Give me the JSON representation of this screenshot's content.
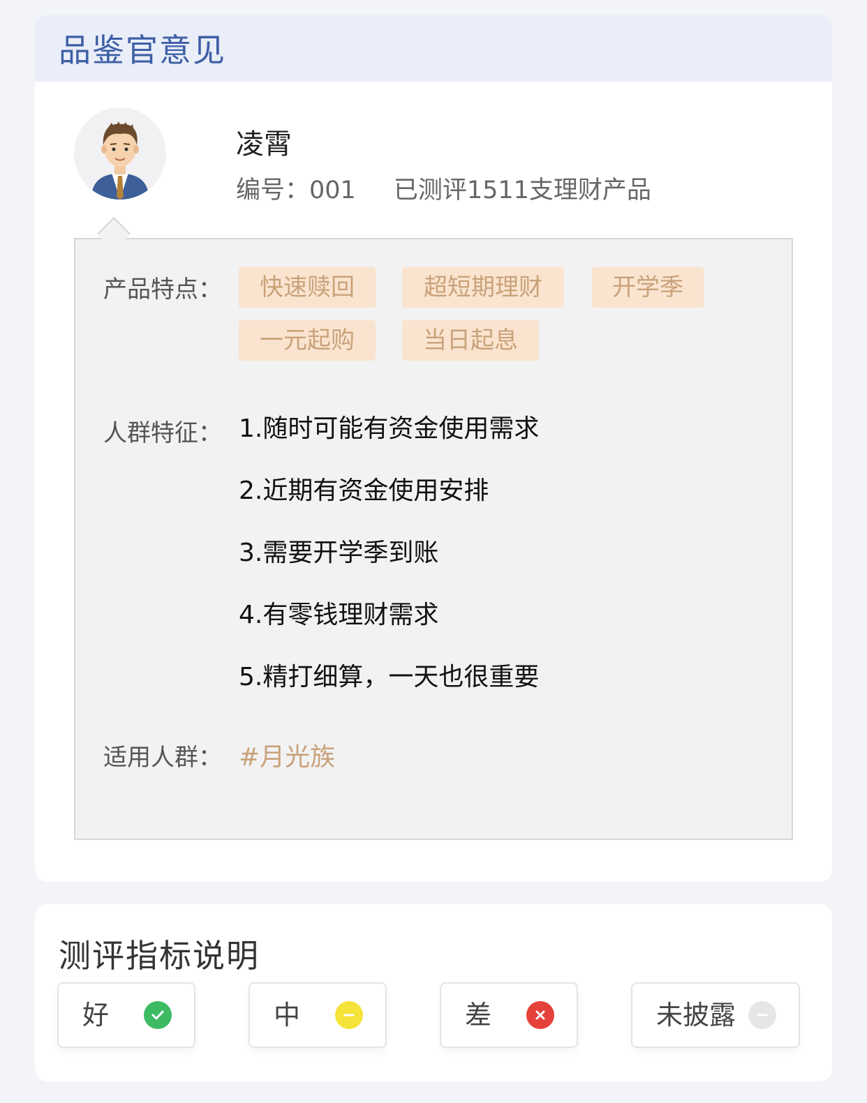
{
  "opinion": {
    "title": "品鉴官意见",
    "reviewer": {
      "name": "凌霄",
      "id_text": "编号：001",
      "reviewed_text": "已测评1511支理财产品"
    },
    "features_label": "产品特点：",
    "tags": [
      "快速赎回",
      "超短期理财",
      "开学季",
      "一元起购",
      "当日起息"
    ],
    "traits_label": "人群特征：",
    "traits": [
      "1.随时可能有资金使用需求",
      "2.近期有资金使用安排",
      "3.需要开学季到账",
      "4.有零钱理财需求",
      "5.精打细算，一天也很重要"
    ],
    "suitable_label": "适用人群：",
    "suitable_value": "#月光族"
  },
  "legend": {
    "title": "测评指标说明",
    "items": [
      {
        "label": "好",
        "icon": "check-circle-icon",
        "color": "#3dbb63"
      },
      {
        "label": "中",
        "icon": "minus-circle-icon",
        "color": "#f6e33a"
      },
      {
        "label": "差",
        "icon": "x-circle-icon",
        "color": "#e6403a"
      },
      {
        "label": "未披露",
        "icon": "minus-circle-icon",
        "color": "#e6e6e8"
      }
    ]
  }
}
